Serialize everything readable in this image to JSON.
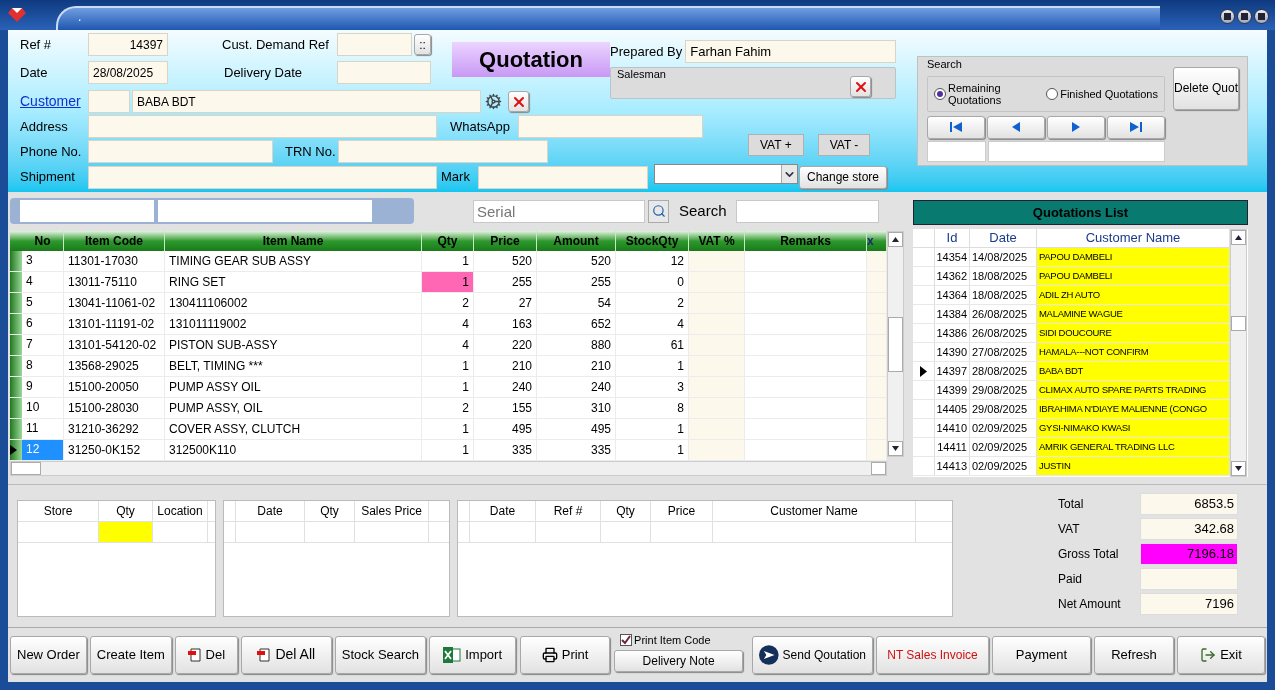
{
  "window": {
    "title": "."
  },
  "header": {
    "ref": {
      "label": "Ref #",
      "value": "14397"
    },
    "date": {
      "label": "Date",
      "value": "28/08/2025"
    },
    "cust_demand_ref": {
      "label": "Cust. Demand Ref",
      "button": "::"
    },
    "delivery_date": {
      "label": "Delivery Date"
    },
    "title": "Quotation",
    "customer": {
      "label": "Customer",
      "name": "BABA BDT"
    },
    "address": {
      "label": "Address"
    },
    "whatsapp": {
      "label": "WhatsApp"
    },
    "phone": {
      "label": "Phone No."
    },
    "trn": {
      "label": "TRN No."
    },
    "shipment": {
      "label": "Shipment"
    },
    "mark": {
      "label": "Mark"
    },
    "prepared_by": {
      "label": "Prepared By",
      "value": "Farhan Fahim"
    },
    "salesman": {
      "label": "Salesman"
    },
    "vat_buttons": [
      "VAT +",
      "VAT -"
    ],
    "change_store": "Change store"
  },
  "search_panel": {
    "title": "Search",
    "options": [
      {
        "label": "Remaining Quotations",
        "selected": true
      },
      {
        "label": "Finished Quotations",
        "selected": false
      }
    ],
    "delete_button": "Delete Quot"
  },
  "toolbar": {
    "serial_placeholder": "Serial",
    "search_label": "Search"
  },
  "items": {
    "columns": [
      "No",
      "Item Code",
      "Item Name",
      "Qty",
      "Price",
      "Amount",
      "StockQty",
      "VAT %",
      "Remarks",
      "x"
    ],
    "rows": [
      {
        "no": "3",
        "code": "11301-17030",
        "name": "TIMING GEAR SUB ASSY",
        "qty": "1",
        "price": "520",
        "amount": "520",
        "stock": "12",
        "qty_highlighted": false,
        "selected": false
      },
      {
        "no": "4",
        "code": "13011-75110",
        "name": "RING SET",
        "qty": "1",
        "price": "255",
        "amount": "255",
        "stock": "0",
        "qty_highlighted": true,
        "selected": false
      },
      {
        "no": "5",
        "code": "13041-11061-02",
        "name": "130411106002",
        "qty": "2",
        "price": "27",
        "amount": "54",
        "stock": "2",
        "qty_highlighted": false,
        "selected": false
      },
      {
        "no": "6",
        "code": "13101-11191-02",
        "name": "131011119002",
        "qty": "4",
        "price": "163",
        "amount": "652",
        "stock": "4",
        "qty_highlighted": false,
        "selected": false
      },
      {
        "no": "7",
        "code": "13101-54120-02",
        "name": "PISTON SUB-ASSY",
        "qty": "4",
        "price": "220",
        "amount": "880",
        "stock": "61",
        "qty_highlighted": false,
        "selected": false
      },
      {
        "no": "8",
        "code": "13568-29025",
        "name": "BELT, TIMING ***",
        "qty": "1",
        "price": "210",
        "amount": "210",
        "stock": "1",
        "qty_highlighted": false,
        "selected": false
      },
      {
        "no": "9",
        "code": "15100-20050",
        "name": "PUMP ASSY OIL",
        "qty": "1",
        "price": "240",
        "amount": "240",
        "stock": "3",
        "qty_highlighted": false,
        "selected": false
      },
      {
        "no": "10",
        "code": "15100-28030",
        "name": "PUMP ASSY, OIL",
        "qty": "2",
        "price": "155",
        "amount": "310",
        "stock": "8",
        "qty_highlighted": false,
        "selected": false
      },
      {
        "no": "11",
        "code": "31210-36292",
        "name": "COVER ASSY, CLUTCH",
        "qty": "1",
        "price": "495",
        "amount": "495",
        "stock": "1",
        "qty_highlighted": false,
        "selected": false
      },
      {
        "no": "12",
        "code": "31250-0K152",
        "name": "312500K110",
        "qty": "1",
        "price": "335",
        "amount": "335",
        "stock": "1",
        "qty_highlighted": false,
        "selected": true
      }
    ]
  },
  "quotations": {
    "title": "Quotations List",
    "columns": [
      "Id",
      "Date",
      "Customer Name"
    ],
    "rows": [
      {
        "id": "14354",
        "date": "14/08/2025",
        "customer": "PAPOU DAMBELI",
        "selected": false
      },
      {
        "id": "14362",
        "date": "18/08/2025",
        "customer": "PAPOU DAMBELI",
        "selected": false
      },
      {
        "id": "14364",
        "date": "18/08/2025",
        "customer": "ADIL ZH AUTO",
        "selected": false
      },
      {
        "id": "14384",
        "date": "26/08/2025",
        "customer": "MALAMINE WAGUE",
        "selected": false
      },
      {
        "id": "14386",
        "date": "26/08/2025",
        "customer": "SIDI DOUCOURE",
        "selected": false
      },
      {
        "id": "14390",
        "date": "27/08/2025",
        "customer": "HAMALA---NOT CONFIRM",
        "selected": false
      },
      {
        "id": "14397",
        "date": "28/08/2025",
        "customer": "BABA BDT",
        "selected": true
      },
      {
        "id": "14399",
        "date": "29/08/2025",
        "customer": "CLIMAX AUTO SPARE PARTS TRADING",
        "selected": false
      },
      {
        "id": "14405",
        "date": "29/08/2025",
        "customer": "IBRAHIMA N'DIAYE MALIENNE (CONGO",
        "selected": false
      },
      {
        "id": "14410",
        "date": "02/09/2025",
        "customer": "GYSI-NIMAKO KWASI",
        "selected": false
      },
      {
        "id": "14411",
        "date": "02/09/2025",
        "customer": "AMRIK GENERAL TRADING LLC",
        "selected": false
      },
      {
        "id": "14413",
        "date": "02/09/2025",
        "customer": "JUSTIN",
        "selected": false
      }
    ]
  },
  "stock_table": {
    "columns": [
      "Store",
      "Qty",
      "Location"
    ]
  },
  "sales_history": {
    "columns": [
      "Date",
      "Qty",
      "Sales Price"
    ]
  },
  "purchase_history": {
    "columns": [
      "Date",
      "Ref #",
      "Qty",
      "Price",
      "Customer Name"
    ]
  },
  "totals": [
    {
      "label": "Total",
      "value": "6853.5",
      "highlighted": false
    },
    {
      "label": "VAT",
      "value": "342.68",
      "highlighted": false
    },
    {
      "label": "Gross Total",
      "value": "7196.18",
      "highlighted": true
    },
    {
      "label": "Paid",
      "highlighted": false
    },
    {
      "label": "Net Amount",
      "value": "7196",
      "highlighted": false
    }
  ],
  "buttons_left": [
    {
      "label": "New Order",
      "kind": "plain"
    },
    {
      "label": "Create Item",
      "kind": "plain"
    },
    {
      "label": "Del",
      "kind": "delete"
    },
    {
      "label": "Del All",
      "kind": "delete"
    },
    {
      "label": "Stock Search",
      "kind": "plain"
    },
    {
      "label": "Import",
      "kind": "excel"
    },
    {
      "label": "Print",
      "kind": "print"
    }
  ],
  "print_item_code": {
    "label": "Print Item Code",
    "checked": true
  },
  "delivery_note": "Delivery Note",
  "buttons_right": [
    {
      "label": "Send Qoutation",
      "kind": "send"
    },
    {
      "label": "NT Sales Invoice",
      "kind": "alert"
    },
    {
      "label": "Payment",
      "kind": "plain"
    },
    {
      "label": "Refresh",
      "kind": "plain"
    },
    {
      "label": "Exit",
      "kind": "exit"
    }
  ]
}
